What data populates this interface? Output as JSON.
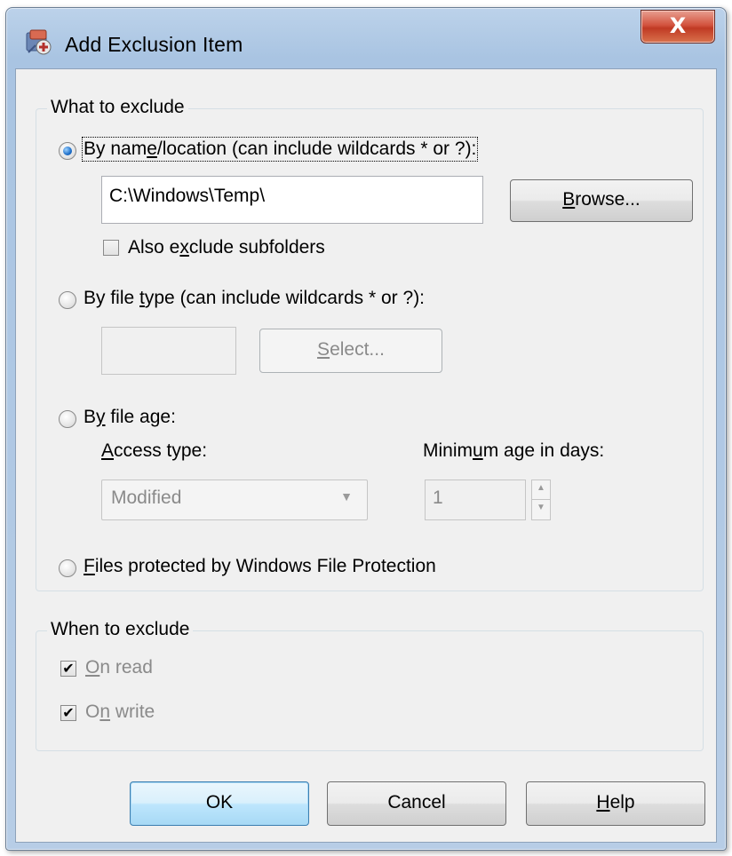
{
  "window": {
    "title": "Add Exclusion Item",
    "close_label": "X"
  },
  "what_group": {
    "title": "What to exclude",
    "by_name": {
      "label_pre": "By nam",
      "label_mn": "e",
      "label_post": "/location (can include wildcards * or ?):",
      "selected": true,
      "path_value": "C:\\Windows\\Temp\\",
      "browse_mn": "B",
      "browse_rest": "rowse...",
      "subfolders_pre": "Also e",
      "subfolders_mn": "x",
      "subfolders_post": "clude subfolders",
      "subfolders_checked": false
    },
    "by_type": {
      "label_pre": "By file ",
      "label_mn": "t",
      "label_post": "ype (can include wildcards * or ?):",
      "selected": false,
      "type_value": "",
      "select_mn": "S",
      "select_rest": "elect..."
    },
    "by_age": {
      "label_pre": "B",
      "label_mn": "y",
      "label_post": " file age:",
      "selected": false,
      "access_mn": "A",
      "access_rest": "ccess type:",
      "access_value": "Modified",
      "min_age_pre": "Minim",
      "min_age_mn": "u",
      "min_age_post": "m age in days:",
      "min_age_value": "1"
    },
    "by_wfp": {
      "label_mn": "F",
      "label_rest": "iles protected by Windows File Protection",
      "selected": false
    }
  },
  "when_group": {
    "title": "When to exclude",
    "on_read": {
      "mn": "O",
      "rest": "n read",
      "checked": true
    },
    "on_write": {
      "pre": "O",
      "mn": "n",
      "post": " write",
      "checked": true
    }
  },
  "buttons": {
    "ok": "OK",
    "cancel": "Cancel",
    "help_mn": "H",
    "help_rest": "elp"
  },
  "colors": {
    "titlebar": "#b7cde6",
    "close": "#c9462f",
    "dialog_bg": "#f0f0f0",
    "disabled_text": "#8a8a8a",
    "default_button": "#bee6fd"
  }
}
